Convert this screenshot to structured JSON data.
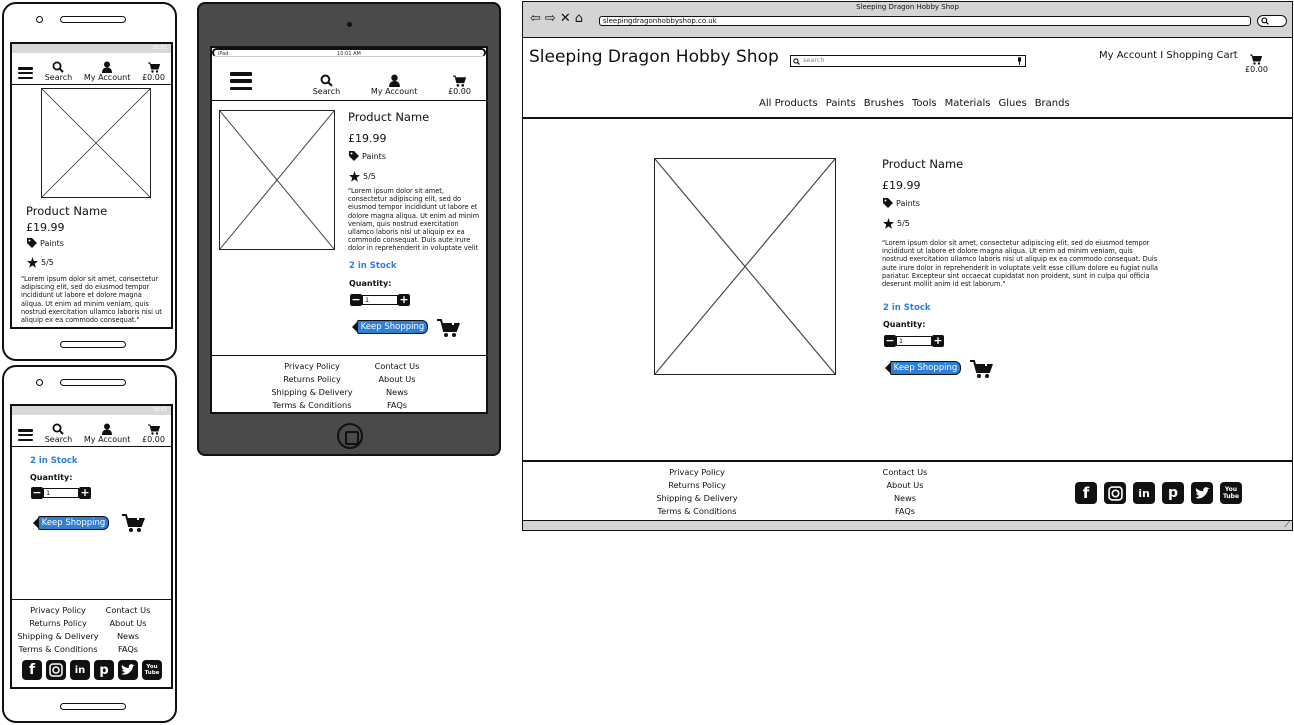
{
  "product": {
    "name": "Product Name",
    "price": "£19.99",
    "category": "Paints",
    "rating": "5/5",
    "description_short": "\"Lorem ipsum dolor sit amet, consectetur adipiscing elit, sed do eiusmod tempor incididunt ut labore et dolore magna aliqua. Ut enim ad minim veniam, quis nostrud exercitation ullamco laboris nisi ut aliquip ex ea commodo consequat.\"",
    "description_ipad": "\"Lorem ipsum dolor sit amet, consectetur adipiscing elit, sed do eiusmod tempor incididunt ut labore et dolore magna aliqua. Ut enim ad minim veniam, quis nostrud exercitation ullamco laboris nisi ut aliquip ex ea commodo consequat. Duis aute irure dolor in reprehenderit in voluptate velit esse cillum dolore eu",
    "description_full": "\"Lorem ipsum dolor sit amet, consectetur adipiscing elit, sed do eiusmod tempor incididunt ut labore et dolore magna aliqua. Ut enim ad minim veniam, quis nostrud exercitation ullamco laboris nisi ut aliquip ex ea commodo consequat. Duis aute irure dolor in reprehenderit in voluptate velit esse cillum dolore eu fugiat nulla pariatur. Excepteur sint occaecat cupidatat non proident, sunt in culpa qui officia deserunt mollit anim id est laborum.\"",
    "stock": "2 in Stock",
    "quantity_label": "Quantity:",
    "quantity_value": "1"
  },
  "nav": {
    "search": "Search",
    "account": "My Account",
    "cart_total": "£0.00"
  },
  "buttons": {
    "keep_shopping": "Keep Shopping"
  },
  "footer": {
    "col1": [
      "Privacy Policy",
      "Returns Policy",
      "Shipping & Delivery",
      "Terms & Conditions"
    ],
    "col2": [
      "Contact Us",
      "About Us",
      "News",
      "FAQs"
    ],
    "socials": [
      "facebook-icon",
      "instagram-icon",
      "linkedin-icon",
      "pinterest-icon",
      "twitter-icon",
      "youtube-icon"
    ]
  },
  "status": {
    "ipad_carrier": "iPad",
    "ipad_time": "10:01 AM",
    "phone_time": "10:01"
  },
  "browser": {
    "window_title": "Sleeping Dragon Hobby Shop",
    "url": "sleepingdragonhobbyshop.co.uk",
    "site_title": "Sleeping Dragon Hobby Shop",
    "search_placeholder": "search",
    "account_links": "My Account I Shopping Cart",
    "categories": [
      "All Products",
      "Paints",
      "Brushes",
      "Tools",
      "Materials",
      "Glues",
      "Brands"
    ]
  },
  "colors": {
    "accent": "#2f7fd6",
    "ipad_body": "#4a4a4a",
    "chrome": "#d4d4d4"
  }
}
